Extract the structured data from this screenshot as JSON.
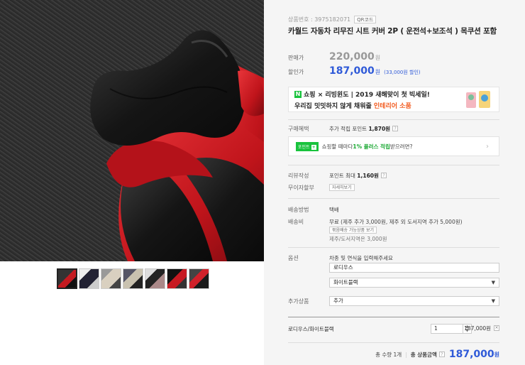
{
  "product": {
    "code_label": "상품번호 : 3975182071",
    "qr_label": "QR코드",
    "title": "카월드 자동차 리무진 시트 커버 2P ( 운전석+보조석 ) 목쿠션 포함"
  },
  "price": {
    "list_label": "판매가",
    "list_value": "220,000",
    "list_unit": "원",
    "sale_label": "할인가",
    "sale_value": "187,000",
    "sale_unit": "원",
    "discount_text": "(33,000원 할인)"
  },
  "banner": {
    "logo": "N",
    "line1": "쇼핑 × 리빙윈도 | 2019 새해맞이 첫 빅세일!",
    "line2_prefix": "우리집 밋밋하지 않게 채워줄 ",
    "line2_highlight": "인테리어 소품"
  },
  "benefit": {
    "label": "구매혜택",
    "text_prefix": "추가 적립 포인트 ",
    "text_value": "1,870원",
    "help": "?"
  },
  "point_box": {
    "tag": "포인트",
    "tag_plus": "+",
    "text_prefix": "쇼핑할 때마다 ",
    "text_highlight": "1% 플러스 적립",
    "text_suffix": " 받으려면?",
    "chevron": "›"
  },
  "review": {
    "label": "리뷰작성",
    "text_prefix": "포인트 최대 ",
    "text_value": "1,160원",
    "help": "?",
    "free_label": "무이자할부",
    "detail_button": "자세히보기"
  },
  "shipping": {
    "method_label": "배송방법",
    "method_value": "택배",
    "fee_label": "배송비",
    "fee_value": "무료 (제주 추가 3,000원, 제주 외 도서지역 추가 5,000원)",
    "bundle_button": "묶음배송 가능상품 보기",
    "island_note": "제주/도서지역은 3,000원"
  },
  "options": {
    "label": "옵션",
    "hint": "차종 및 연식을 입력해주세요",
    "input_value": "로디우스",
    "select_value": "화이트블랙",
    "extra_label": "추가상품",
    "extra_value": "추가"
  },
  "selected": {
    "name": "로디우스/화이트블랙",
    "qty": "1",
    "price": "187,000원",
    "remove": "×"
  },
  "total": {
    "count_text": "총 수량 1개",
    "label": "총 상품금액",
    "help": "?",
    "amount": "187,000",
    "unit": "원"
  },
  "colors": {
    "accent_blue": "#2f5ad8",
    "naver_green": "#19c33d",
    "seat_red": "#d81d24",
    "seat_black": "#1a1a1a"
  }
}
